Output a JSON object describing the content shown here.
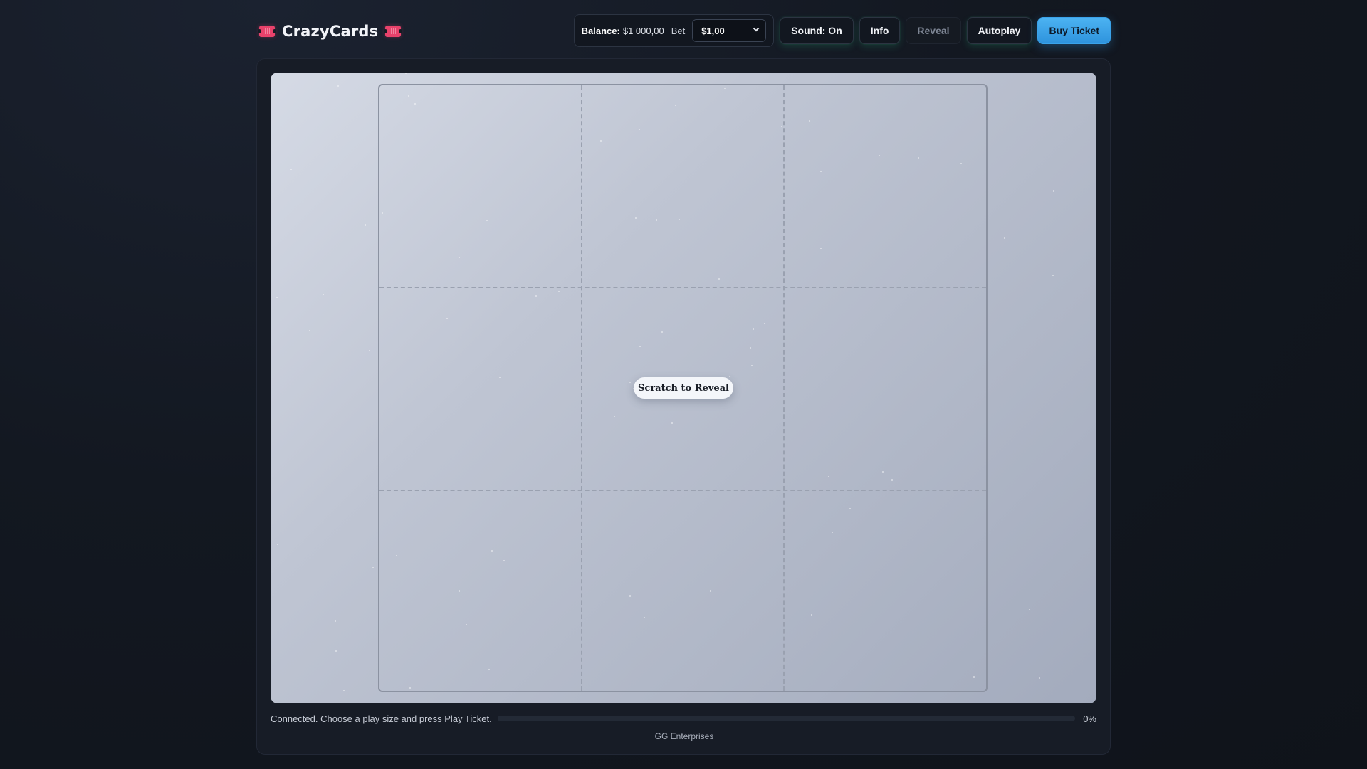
{
  "header": {
    "title": "CrazyCards",
    "left_icon": "ticket-icon",
    "right_icon": "ticket-icon",
    "accent_color": "#e8426b"
  },
  "balance": {
    "label": "Balance:",
    "value": "$1 000,00"
  },
  "bet": {
    "label": "Bet",
    "selected": "$1,00"
  },
  "buttons": {
    "sound": "Sound: On",
    "info": "Info",
    "reveal": "Reveal",
    "autoplay": "Autoplay",
    "buy": "Buy Ticket"
  },
  "card": {
    "overlay_text": "Scratch to Reveal",
    "rows": 3,
    "cols": 3
  },
  "status": {
    "message": "Connected. Choose a play size and press Play Ticket.",
    "progress_label": "0%",
    "progress_value": 0
  },
  "footer": {
    "text": "GG Enterprises"
  }
}
